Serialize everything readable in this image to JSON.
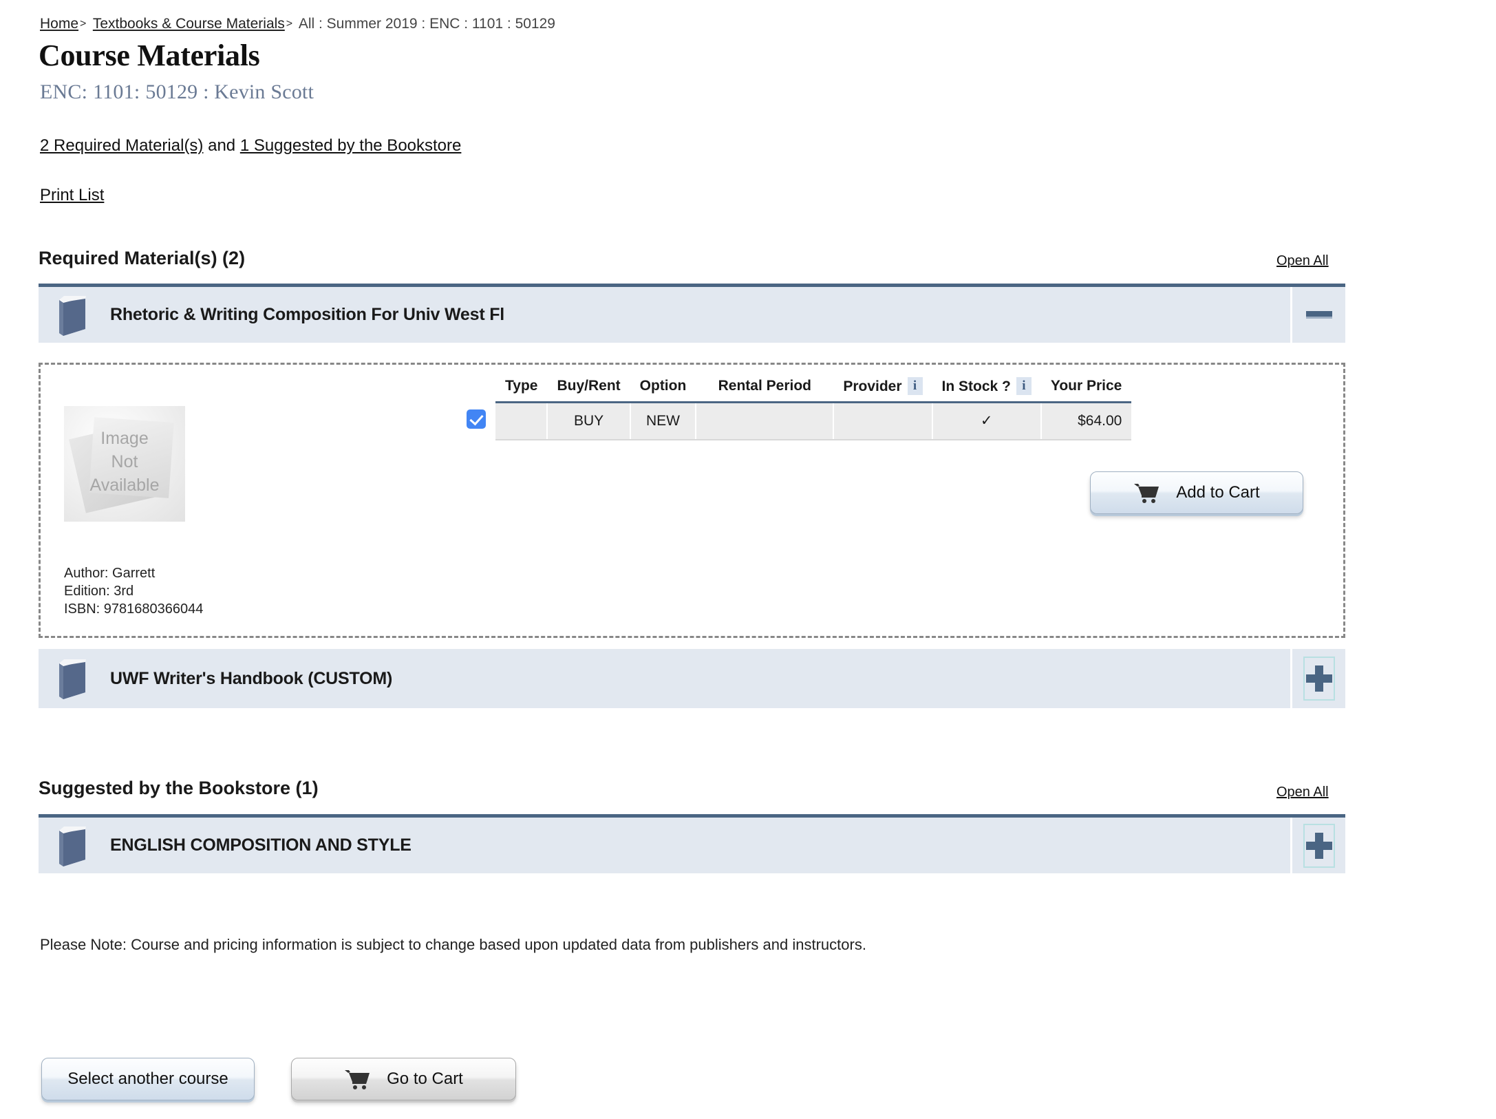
{
  "breadcrumb": {
    "home": "Home",
    "textbooks": "Textbooks & Course Materials",
    "separator": ">",
    "current": "All : Summer 2019 : ENC : 1101 : 50129"
  },
  "header": {
    "page_title": "Course Materials",
    "course_dept": "ENC:",
    "course_number": "1101:",
    "course_section": "50129 : Kevin Scott",
    "counts_required": "2 Required Material(s)",
    "counts_conjunction": "and",
    "counts_suggested": "1 Suggested by the Bookstore",
    "print_list": "Print List"
  },
  "sections": [
    {
      "heading": "Required Material(s) (2)",
      "open_all": "Open All",
      "items": [
        {
          "title": "Rhetoric & Writing Composition For Univ West Fl",
          "expanded": true,
          "toggle_icon": "minus-icon",
          "cover_placeholder": [
            "Image",
            "Not",
            "Available"
          ],
          "meta": [
            "Author: Garrett",
            "Edition: 3rd",
            "ISBN: 9781680366044"
          ],
          "table": {
            "columns": [
              "Type",
              "Buy/Rent",
              "Option",
              "Rental Period",
              "Provider",
              "In Stock ?",
              "Your Price"
            ],
            "info_columns": [
              "Provider",
              "In Stock ?"
            ],
            "info_glyph": "i",
            "rows": [
              {
                "selected": true,
                "Type": "",
                "Buy/Rent": "BUY",
                "Option": "NEW",
                "Rental Period": "",
                "Provider": "",
                "In Stock ?": "✓",
                "Your Price": "$64.00"
              }
            ]
          },
          "add_to_cart": "Add to Cart"
        },
        {
          "title": "UWF Writer's Handbook (CUSTOM)",
          "expanded": false,
          "toggle_icon": "plus-icon"
        }
      ]
    },
    {
      "heading": "Suggested by the Bookstore (1)",
      "open_all": "Open All",
      "items": [
        {
          "title": "ENGLISH COMPOSITION AND STYLE",
          "expanded": false,
          "toggle_icon": "plus-icon"
        }
      ]
    }
  ],
  "note": "Please Note: Course and pricing information is subject to change based upon updated data from publishers and instructors.",
  "footer": {
    "select_another_course": "Select another course",
    "go_to_cart": "Go to Cart"
  },
  "colors": {
    "accordion_bg": "#e2e8f0",
    "accordion_border": "#4a6583",
    "course_text": "#6a7a94",
    "checkbox": "#4285f4",
    "info_badge_bg": "#dbe4f0",
    "book_icon": "#5b6f90"
  }
}
